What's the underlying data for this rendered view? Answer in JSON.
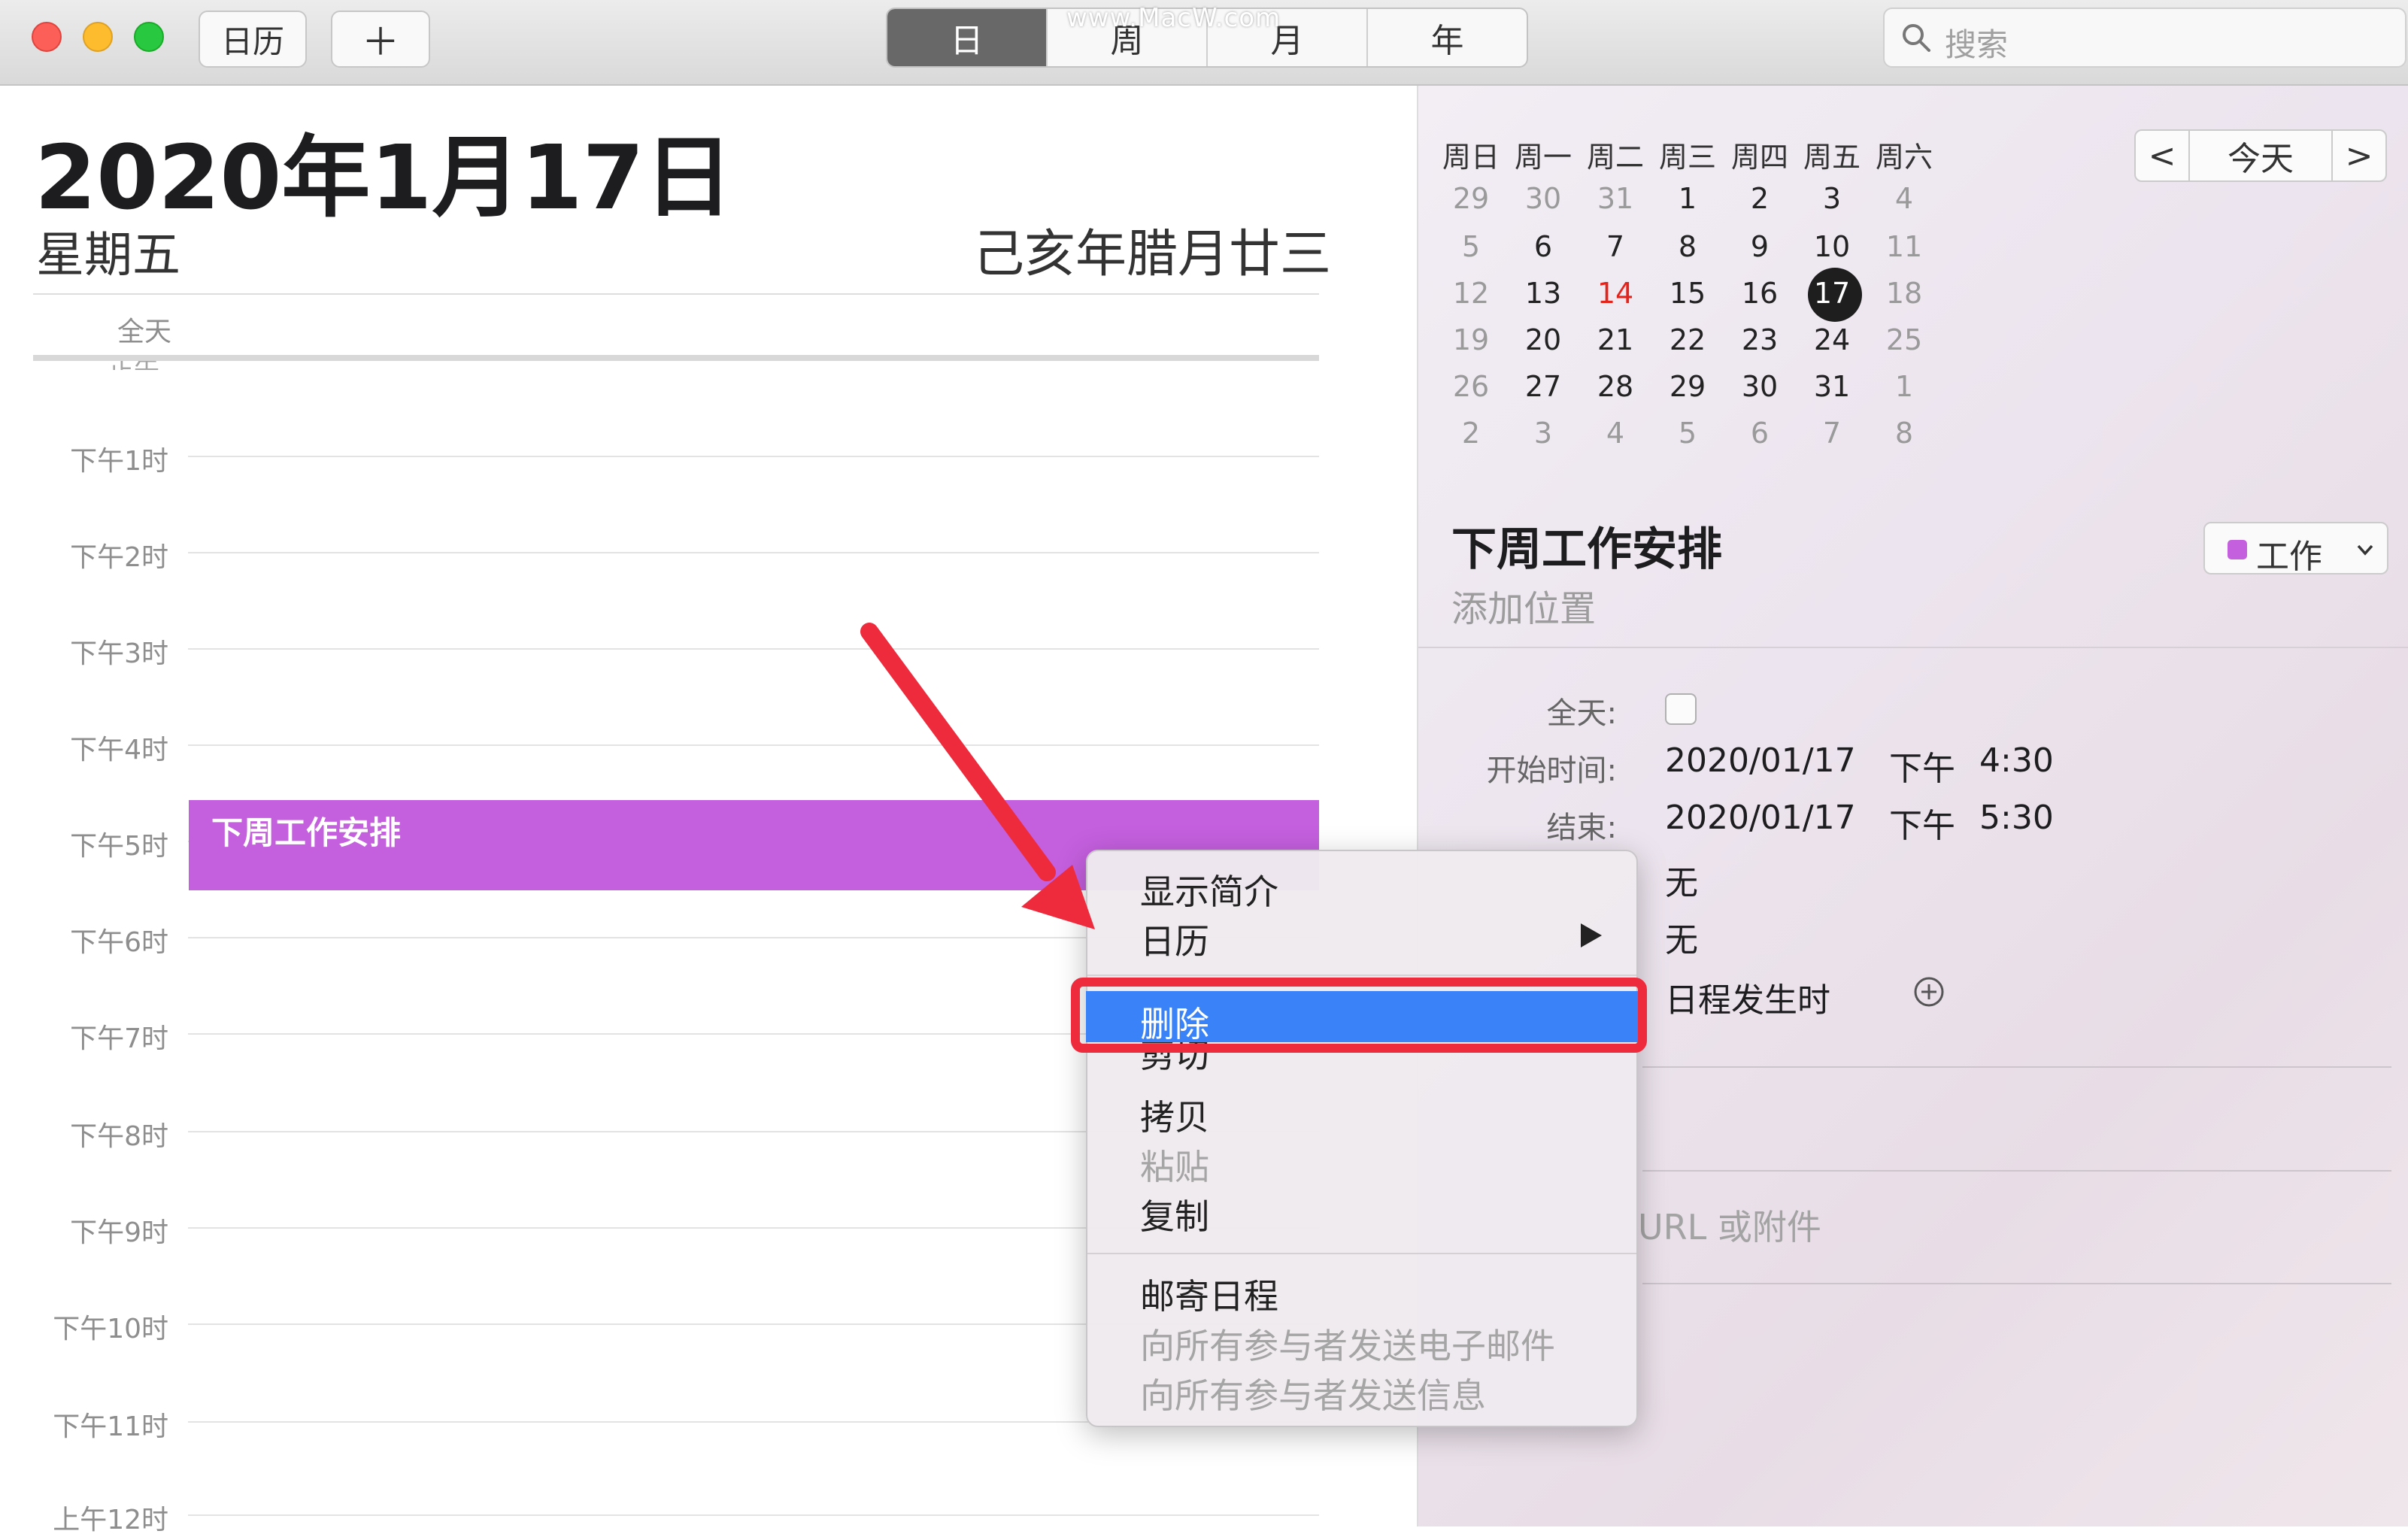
{
  "toolbar": {
    "calendars_button": "日历",
    "add_button": "＋",
    "view_tabs": [
      "日",
      "周",
      "月",
      "年"
    ],
    "watermark": "www.MacW.com",
    "search_placeholder": "搜索"
  },
  "day_view": {
    "date_title": "2020年1月17日",
    "weekday": "星期五",
    "lunar_date": "己亥年腊月廿三",
    "all_day_label": "全天",
    "cut_label": "正午",
    "hours": [
      "下午1时",
      "下午2时",
      "下午3时",
      "下午4时",
      "下午5时",
      "下午6时",
      "下午7时",
      "下午8时",
      "下午9时",
      "下午10时",
      "下午11时",
      "上午12时"
    ],
    "event_title": "下周工作安排"
  },
  "mini_calendar": {
    "weekdays": [
      "周日",
      "周一",
      "周二",
      "周三",
      "周四",
      "周五",
      "周六"
    ],
    "weeks": [
      [
        "29",
        "30",
        "31",
        "1",
        "2",
        "3",
        "4"
      ],
      [
        "5",
        "6",
        "7",
        "8",
        "9",
        "10",
        "11"
      ],
      [
        "12",
        "13",
        "14",
        "15",
        "16",
        "17",
        "18"
      ],
      [
        "19",
        "20",
        "21",
        "22",
        "23",
        "24",
        "25"
      ],
      [
        "26",
        "27",
        "28",
        "29",
        "30",
        "31",
        "1"
      ],
      [
        "2",
        "3",
        "4",
        "5",
        "6",
        "7",
        "8"
      ]
    ],
    "prev": "<",
    "today": "今天",
    "next": ">"
  },
  "inspector": {
    "title": "下周工作安排",
    "location_placeholder": "添加位置",
    "calendar_name": "工作",
    "calendar_color": "#c45fde",
    "all_day_label": "全天:",
    "start_label": "开始时间:",
    "start_date": "2020/01/17",
    "start_ampm": "下午",
    "start_time": "4:30",
    "end_label": "结束:",
    "end_date": "2020/01/17",
    "end_ampm": "下午",
    "end_time": "5:30",
    "repeat_value": "无",
    "travel_value": "无",
    "alert_value": "日程发生时",
    "url_placeholder": "URL 或附件"
  },
  "context_menu": {
    "show_info": "显示简介",
    "calendar": "日历",
    "delete": "删除",
    "cut": "剪切",
    "copy": "拷贝",
    "paste": "粘贴",
    "duplicate": "复制",
    "mail_event": "邮寄日程",
    "email_all": "向所有参与者发送电子邮件",
    "message_all": "向所有参与者发送信息"
  },
  "colors": {
    "event": "#c45fde",
    "highlight": "#3a82f7",
    "annotation": "#ee2b3d",
    "today": "#e4241b"
  }
}
